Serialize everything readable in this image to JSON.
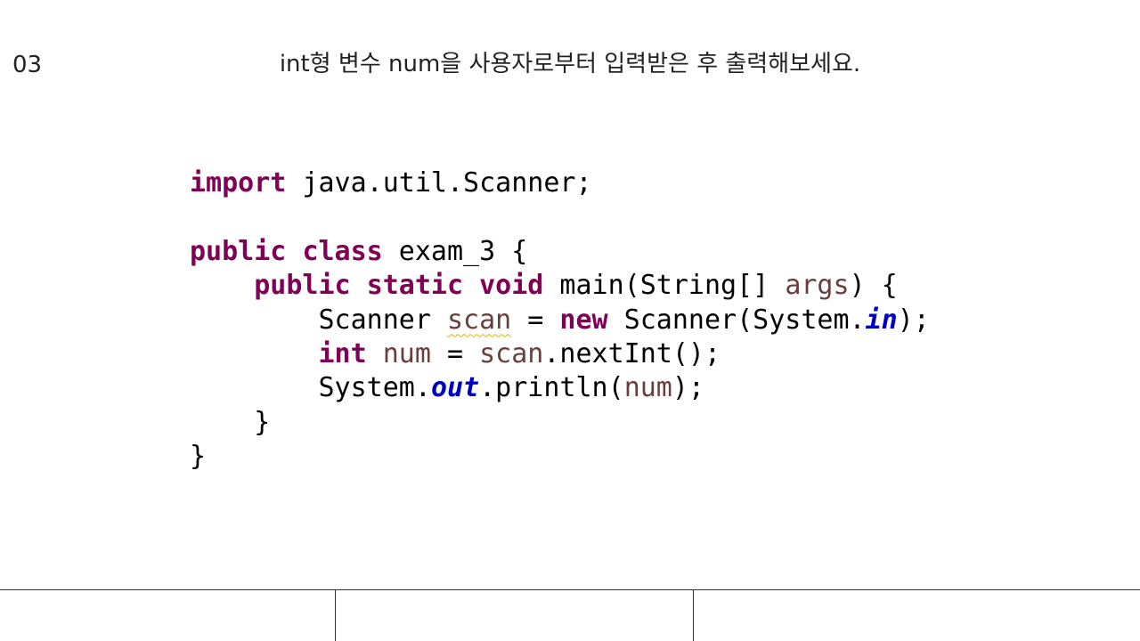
{
  "slide": {
    "number": "03",
    "title": "int형 변수 num을 사용자로부터 입력받은 후 출력해보세요."
  },
  "code": {
    "language": "java",
    "lines": [
      [
        {
          "t": "import",
          "k": "kw"
        },
        {
          "t": " java.util.Scanner;",
          "k": "plain"
        }
      ],
      [],
      [
        {
          "t": "public",
          "k": "kw"
        },
        {
          "t": " ",
          "k": "plain"
        },
        {
          "t": "class",
          "k": "kw"
        },
        {
          "t": " exam_3 {",
          "k": "plain"
        }
      ],
      [
        {
          "t": "    ",
          "k": "plain"
        },
        {
          "t": "public",
          "k": "kw"
        },
        {
          "t": " ",
          "k": "plain"
        },
        {
          "t": "static",
          "k": "kw"
        },
        {
          "t": " ",
          "k": "plain"
        },
        {
          "t": "void",
          "k": "kw"
        },
        {
          "t": " main(String[] ",
          "k": "plain"
        },
        {
          "t": "args",
          "k": "var"
        },
        {
          "t": ") {",
          "k": "plain"
        }
      ],
      [
        {
          "t": "        Scanner ",
          "k": "plain"
        },
        {
          "t": "scan",
          "k": "var",
          "warn": true
        },
        {
          "t": " = ",
          "k": "plain"
        },
        {
          "t": "new",
          "k": "kw"
        },
        {
          "t": " Scanner(System.",
          "k": "plain"
        },
        {
          "t": "in",
          "k": "field"
        },
        {
          "t": ");",
          "k": "plain"
        }
      ],
      [
        {
          "t": "        ",
          "k": "plain"
        },
        {
          "t": "int",
          "k": "kw"
        },
        {
          "t": " ",
          "k": "plain"
        },
        {
          "t": "num",
          "k": "var"
        },
        {
          "t": " = ",
          "k": "plain"
        },
        {
          "t": "scan",
          "k": "var"
        },
        {
          "t": ".nextInt();",
          "k": "plain"
        }
      ],
      [
        {
          "t": "        System.",
          "k": "plain"
        },
        {
          "t": "out",
          "k": "field"
        },
        {
          "t": ".println(",
          "k": "plain"
        },
        {
          "t": "num",
          "k": "var"
        },
        {
          "t": ");",
          "k": "plain"
        }
      ],
      [
        {
          "t": "    }",
          "k": "plain"
        }
      ],
      [
        {
          "t": "}",
          "k": "plain"
        }
      ]
    ]
  },
  "colors": {
    "keyword": "#7f0055",
    "variable": "#6a3e3e",
    "static_field": "#0000c0",
    "plain": "#000000",
    "warning_underline": "#e0b400"
  }
}
